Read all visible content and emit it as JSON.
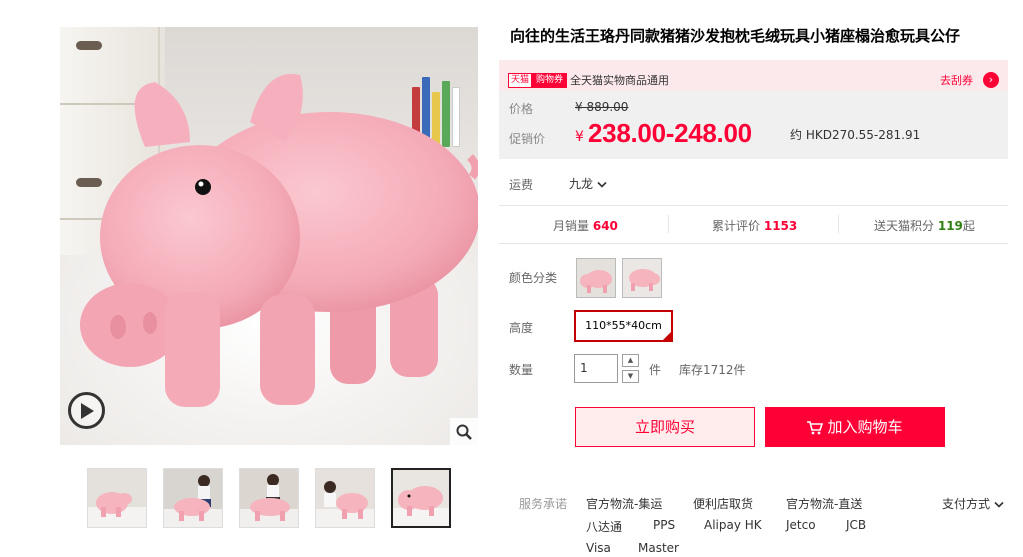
{
  "product": {
    "title": "向往的生活王珞丹同款猪猪沙发抱枕毛绒玩具小猪座榻治愈玩具公仔"
  },
  "coupon": {
    "badge_left": "天猫",
    "badge_right": "购物券",
    "text": "全天猫实物商品通用",
    "link": "去刮券",
    "arrow": "›"
  },
  "price": {
    "original_label": "价格",
    "original_value": "¥ 889.00",
    "promo_label": "促销价",
    "currency": "¥",
    "promo_value": "238.00-248.00",
    "hkd": "约 HKD270.55-281.91"
  },
  "shipping": {
    "label": "运费",
    "destination": "九龙"
  },
  "stats": {
    "monthly_label": "月销量",
    "monthly_value": "640",
    "reviews_label": "累计评价",
    "reviews_value": "1153",
    "points_label": "送天猫积分",
    "points_value": "119",
    "points_suffix": "起"
  },
  "options": {
    "color_label": "颜色分类",
    "height_label": "高度",
    "height_value": "110*55*40cm",
    "qty_label": "数量",
    "qty_value": "1",
    "qty_up": "▲",
    "qty_down": "▼",
    "qty_unit": "件",
    "stock": "库存1712件"
  },
  "actions": {
    "buy_now": "立即购买",
    "add_cart": "加入购物车"
  },
  "services": {
    "label": "服务承诺",
    "items": [
      "官方物流-集运",
      "便利店取货",
      "官方物流-直送",
      "八达通",
      "PPS",
      "Alipay HK",
      "Jetco",
      "JCB",
      "Visa",
      "Master"
    ],
    "pay_method": "支付方式"
  },
  "colors": {
    "accent": "#ff0036",
    "pig_pink": "#f5b4be"
  }
}
